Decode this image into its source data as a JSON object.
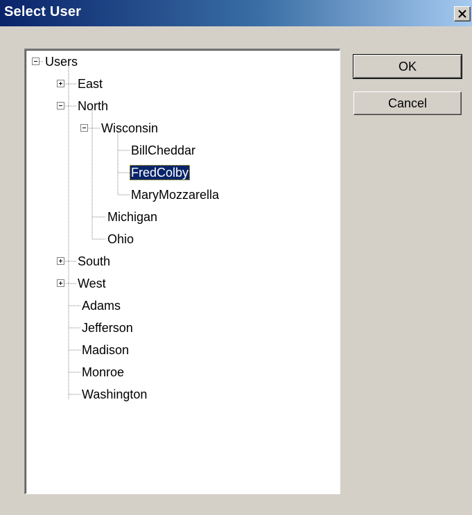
{
  "window": {
    "title": "Select User",
    "close_icon": "close-icon"
  },
  "buttons": {
    "ok": "OK",
    "cancel": "Cancel"
  },
  "tree": {
    "root": "Users",
    "east": "East",
    "north": "North",
    "wisconsin": "Wisconsin",
    "billcheddar": "BillCheddar",
    "fredcolby": "FredColby",
    "marymozzarella": "MaryMozzarella",
    "michigan": "Michigan",
    "ohio": "Ohio",
    "south": "South",
    "west": "West",
    "adams": "Adams",
    "jefferson": "Jefferson",
    "madison": "Madison",
    "monroe": "Monroe",
    "washington": "Washington",
    "selected": "FredColby"
  },
  "colors": {
    "titlebar_start": "#0a246a",
    "titlebar_end": "#a6caf0",
    "selection": "#0a246a",
    "dialog_bg": "#d4d0c8"
  }
}
